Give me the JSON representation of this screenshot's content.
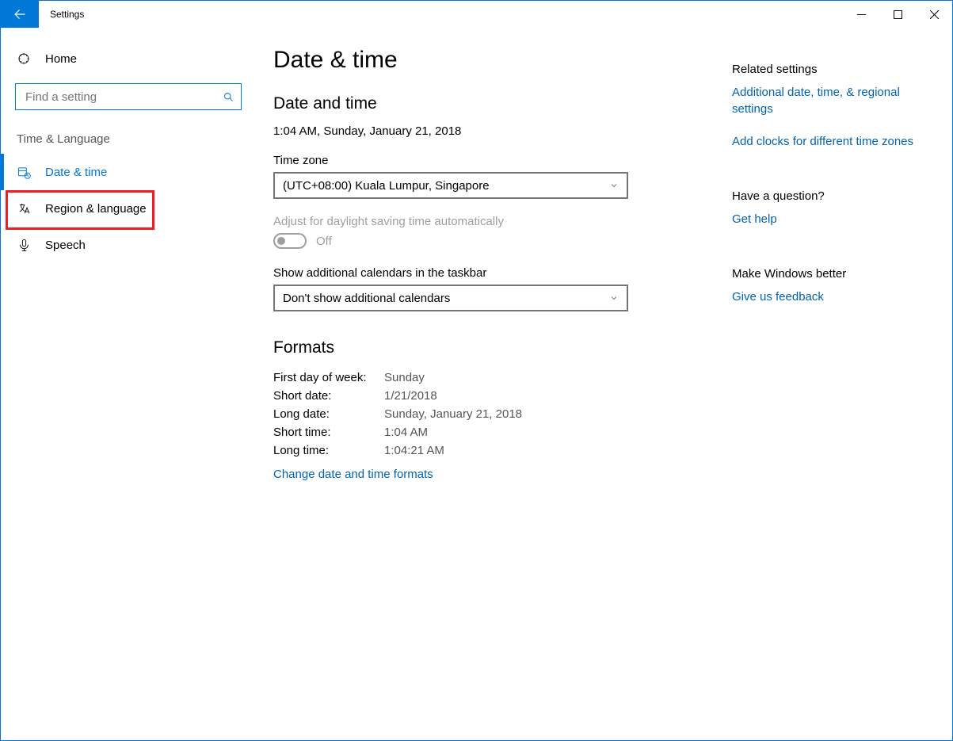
{
  "window": {
    "title": "Settings"
  },
  "sidebar": {
    "home": "Home",
    "search_placeholder": "Find a setting",
    "group": "Time & Language",
    "items": [
      {
        "label": "Date & time",
        "icon": "calendar-clock",
        "selected": true,
        "highlight": false
      },
      {
        "label": "Region & language",
        "icon": "language",
        "selected": false,
        "highlight": true
      },
      {
        "label": "Speech",
        "icon": "microphone",
        "selected": false,
        "highlight": false
      }
    ]
  },
  "page": {
    "heading": "Date & time",
    "date_time": {
      "section_title": "Date and time",
      "current": "1:04 AM, Sunday, January 21, 2018",
      "timezone_label": "Time zone",
      "timezone_value": "(UTC+08:00) Kuala Lumpur, Singapore",
      "dst_label": "Adjust for daylight saving time automatically",
      "dst_state": "Off",
      "dst_enabled": false,
      "extra_cal_label": "Show additional calendars in the taskbar",
      "extra_cal_value": "Don't show additional calendars"
    },
    "formats": {
      "section_title": "Formats",
      "rows": [
        {
          "k": "First day of week:",
          "v": "Sunday"
        },
        {
          "k": "Short date:",
          "v": "1/21/2018"
        },
        {
          "k": "Long date:",
          "v": "Sunday, January 21, 2018"
        },
        {
          "k": "Short time:",
          "v": "1:04 AM"
        },
        {
          "k": "Long time:",
          "v": "1:04:21 AM"
        }
      ],
      "change_link": "Change date and time formats"
    }
  },
  "rail": {
    "related_title": "Related settings",
    "related_links": [
      "Additional date, time, & regional settings",
      "Add clocks for different time zones"
    ],
    "help_title": "Have a question?",
    "help_link": "Get help",
    "feedback_title": "Make Windows better",
    "feedback_link": "Give us feedback"
  }
}
